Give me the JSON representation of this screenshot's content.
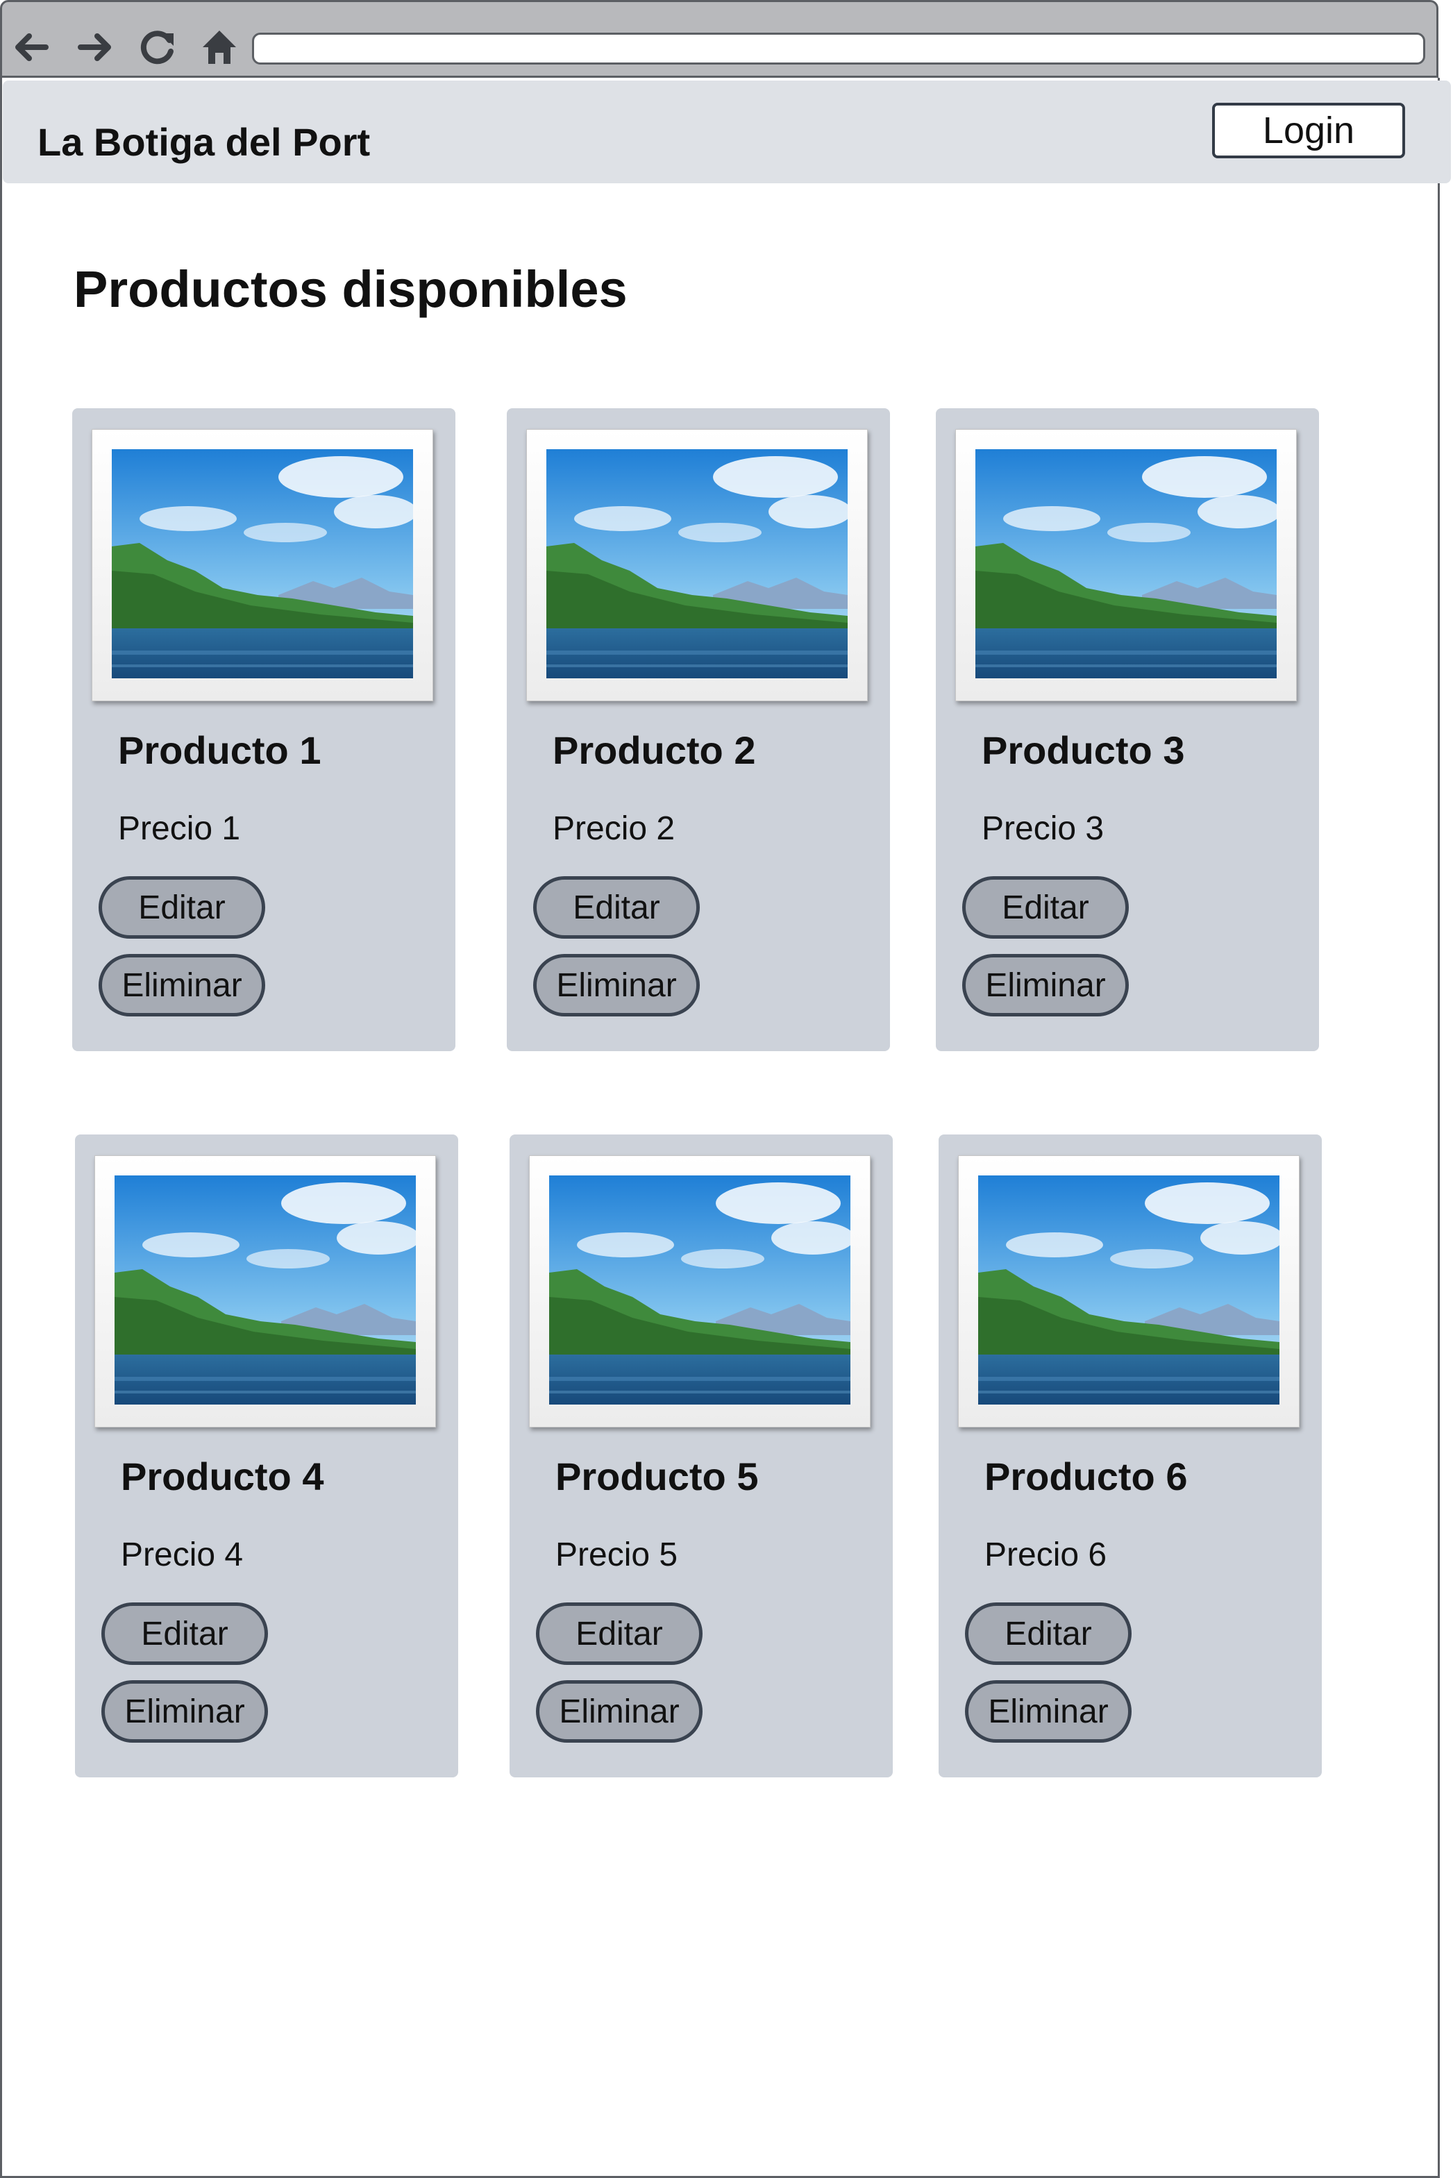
{
  "browser": {
    "url": ""
  },
  "header": {
    "brand": "La Botiga del Port",
    "login_label": "Login"
  },
  "main": {
    "title": "Productos disponibles",
    "products": [
      {
        "name": "Producto 1",
        "price": "Precio 1",
        "edit_label": "Editar",
        "delete_label": "Eliminar"
      },
      {
        "name": "Producto 2",
        "price": "Precio 2",
        "edit_label": "Editar",
        "delete_label": "Eliminar"
      },
      {
        "name": "Producto 3",
        "price": "Precio 3",
        "edit_label": "Editar",
        "delete_label": "Eliminar"
      },
      {
        "name": "Producto 4",
        "price": "Precio 4",
        "edit_label": "Editar",
        "delete_label": "Eliminar"
      },
      {
        "name": "Producto 5",
        "price": "Precio 5",
        "edit_label": "Editar",
        "delete_label": "Eliminar"
      },
      {
        "name": "Producto 6",
        "price": "Precio 6",
        "edit_label": "Editar",
        "delete_label": "Eliminar"
      }
    ]
  },
  "icons": {
    "back": "arrow-left-icon",
    "forward": "arrow-right-icon",
    "reload": "reload-icon",
    "home": "home-icon",
    "product_image": "landscape-image-icon"
  },
  "colors": {
    "header_bg": "#dee1e6",
    "card_bg": "#cdd2da",
    "button_bg": "#a6abb4",
    "button_border": "#3a4350",
    "chrome_bg": "#b8b9bc"
  }
}
